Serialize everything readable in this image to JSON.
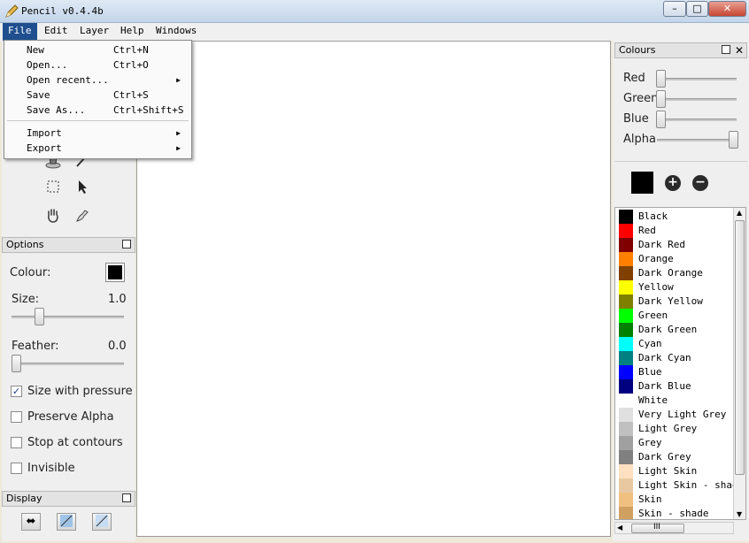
{
  "window": {
    "title": "Pencil v0.4.4b",
    "minimize": "▭",
    "maximize": "□",
    "close": "✕"
  },
  "menubar": {
    "items": [
      "File",
      "Edit",
      "Layer",
      "Help",
      "Windows"
    ]
  },
  "file_menu": {
    "items": [
      {
        "label": "New",
        "shortcut": "Ctrl+N"
      },
      {
        "label": "Open...",
        "shortcut": "Ctrl+O"
      },
      {
        "label": "Open recent...",
        "shortcut": "",
        "submenu": true
      },
      {
        "label": "Save",
        "shortcut": "Ctrl+S"
      },
      {
        "label": "Save As...",
        "shortcut": "Ctrl+Shift+S"
      },
      {
        "label": "Import",
        "shortcut": "",
        "submenu": true
      },
      {
        "label": "Export",
        "shortcut": "",
        "submenu": true
      }
    ]
  },
  "tools": [
    "bucket-icon",
    "eyedropper-icon",
    "select-icon",
    "pointer-icon",
    "hand-icon",
    "smudge-icon"
  ],
  "options": {
    "title": "Options",
    "colour_label": "Colour:",
    "colour_value": "#000000",
    "size_label": "Size:",
    "size_value": "1.0",
    "feather_label": "Feather:",
    "feather_value": "0.0",
    "size_with_pressure": "Size with pressure",
    "size_with_pressure_checked": "✓",
    "preserve_alpha": "Preserve Alpha",
    "stop_at_contours": "Stop at contours",
    "invisible": "Invisible"
  },
  "display": {
    "title": "Display"
  },
  "colours": {
    "title": "Colours",
    "red_label": "Red",
    "green_label": "Green",
    "blue_label": "Blue",
    "alpha_label": "Alpha",
    "add": "+",
    "remove": "−",
    "current": "#000000"
  },
  "palette": [
    {
      "name": "Black",
      "color": "#000000"
    },
    {
      "name": "Red",
      "color": "#ff0000"
    },
    {
      "name": "Dark Red",
      "color": "#800000"
    },
    {
      "name": "Orange",
      "color": "#ff8000"
    },
    {
      "name": "Dark Orange",
      "color": "#804000"
    },
    {
      "name": "Yellow",
      "color": "#ffff00"
    },
    {
      "name": "Dark Yellow",
      "color": "#808000"
    },
    {
      "name": "Green",
      "color": "#00ff00"
    },
    {
      "name": "Dark Green",
      "color": "#008000"
    },
    {
      "name": "Cyan",
      "color": "#00ffff"
    },
    {
      "name": "Dark Cyan",
      "color": "#008080"
    },
    {
      "name": "Blue",
      "color": "#0000ff"
    },
    {
      "name": "Dark Blue",
      "color": "#000080"
    },
    {
      "name": "White",
      "color": "#ffffff"
    },
    {
      "name": "Very Light Grey",
      "color": "#e0e0e0"
    },
    {
      "name": "Light Grey",
      "color": "#c0c0c0"
    },
    {
      "name": "Grey",
      "color": "#a0a0a0"
    },
    {
      "name": "Dark Grey",
      "color": "#808080"
    },
    {
      "name": "Light Skin",
      "color": "#ffe0c0"
    },
    {
      "name": "Light Skin - shade",
      "color": "#e8c8a0"
    },
    {
      "name": "Skin",
      "color": "#f0c080"
    },
    {
      "name": "Skin - shade",
      "color": "#d0a060"
    }
  ],
  "hscroll_label": "III"
}
